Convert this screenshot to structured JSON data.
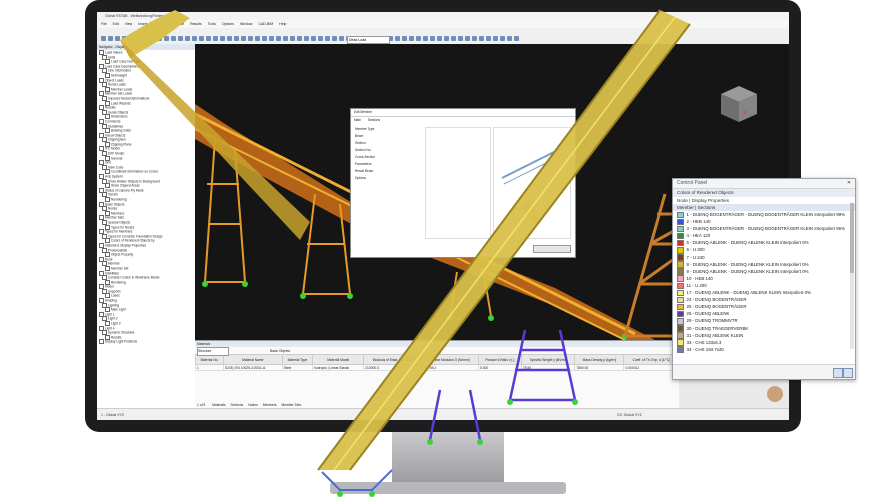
{
  "app": {
    "title": "Global RSTAB - Weitbandlung/Förderer_2_.rs9*",
    "menu": [
      "File",
      "Edit",
      "View",
      "Insert",
      "Assign",
      "Calculate",
      "Results",
      "Tools",
      "Options",
      "Window",
      "CAD-BIM",
      "Help"
    ],
    "load_case": "Dead Load"
  },
  "navigator": {
    "title": "Navigator - Display",
    "items": [
      "Load Values",
      "Units",
      "Load Case Numbers",
      "Load Case Descriptions",
      "Line Information",
      "Self-weight",
      "Object Loads",
      "Nodal Loads",
      "Member Loads",
      "Member Set Loads",
      "Imposed Nodal Deformations",
      "Load Wizards",
      "Results",
      "Guide Objects",
      "Dimensions",
      "Comments",
      "Guidelines",
      "Building Grids",
      "Visual Objects",
      "Clipping Box",
      "Clipping Plane",
      "IFC Model",
      "DXF Model",
      "General",
      "Grid",
      "View Cube",
      "Coordinate Information on Cursor",
      "Axis System",
      "Show Hidden Objects in Background",
      "Show Clipped Areas",
      "Status of Camera Fly Mode",
      "Terrain",
      "Numbering",
      "Basic Objects",
      "Nodes",
      "Members",
      "Member Sets",
      "Special Objects",
      "Types for Nodes",
      "Types for Members",
      "Types for Concrete Foundation Design",
      "Colors of Rendered Objects by",
      "Material & Display Properties",
      "Photorealistic",
      "Object Property",
      "Node",
      "Member",
      "Member Set",
      "Visibilities",
      "Consider Colors in Wireframe Model",
      "Rendering",
      "Model",
      "Supports",
      "Loads",
      "Shading",
      "Lighting",
      "Main Light",
      "Light 1",
      "Light 2",
      "Light 3",
      "Light 4",
      "Dynamic Shadows",
      "Results",
      "Display Light Positions"
    ]
  },
  "table": {
    "title": "Materials",
    "filter": "Structure",
    "buttons": [
      "Basic Objects"
    ],
    "headers": [
      "Material No.",
      "Material Name",
      "Material Type",
      "Material Model",
      "Modulus of Elast. E [N/mm²]",
      "Shear Modulus G [N/mm²]",
      "Poisson's Ratio v [-]",
      "Specific Weight γ [kN/m³]",
      "Mass Density ρ [kg/m³]",
      "Coeff. of Th. Exp. α [1/°C]"
    ],
    "rows": [
      [
        "1",
        "S235 | EN 10025-2:2004-11",
        "Steel",
        "Isotropic | Linear Elastic",
        "210000.0",
        "80769.2",
        "0.300",
        "78.50",
        "7850.00",
        "0.000012"
      ]
    ],
    "pagination": "1 of 5",
    "tabs": [
      "Materials",
      "Sections",
      "Nodes",
      "Members",
      "Member Sets"
    ]
  },
  "statusbar": {
    "left": "1 - Global XYZ",
    "right": "CS: Global XYZ"
  },
  "control_panel": {
    "title": "Control Panel",
    "subtitle": "Colors of Rendered Objects",
    "group": "Node | Display Properties",
    "section": "Member | Sections",
    "items": [
      {
        "label": "1 - DUENQ BOGENTRÄGER - DUENQ BOGENTRÄGER KLEIN Interpoliert 99%",
        "color": "#7fd0e8"
      },
      {
        "label": "2 - HEB 140",
        "color": "#2a55d8"
      },
      {
        "label": "3 - DUENQ BOGENTRÄGER - DUENQ BOGENTRÄGER KLEIN Interpoliert 95%",
        "color": "#7ed1c7"
      },
      {
        "label": "4 - HEA 120",
        "color": "#3b8a3b"
      },
      {
        "label": "5 - DUENQ ABLENK - DUENQ ABLENK KLEIN Interpoliert 0%",
        "color": "#e0282a"
      },
      {
        "label": "6 - U 300",
        "color": "#d9c500"
      },
      {
        "label": "7 - U 240",
        "color": "#7a3f1f"
      },
      {
        "label": "8 - DUENQ ABLENK - DUENQ ABLENK KLEIN Interpoliert 0%",
        "color": "#d6b43a"
      },
      {
        "label": "9 - DUENQ ABLENK - DUENQ ABLENK KLEIN Interpoliert 0%",
        "color": "#8c7c2e"
      },
      {
        "label": "10 - HEB 140",
        "color": "#f2a6b8"
      },
      {
        "label": "11 - U 200",
        "color": "#f06f6f"
      },
      {
        "label": "17 - DUENQ ABLENK - DUENQ ABLENK KLEIN Interpoliert 0%",
        "color": "#f5ef72"
      },
      {
        "label": "24 - DUENQ BOGENTRÄGER",
        "color": "#efd9a3"
      },
      {
        "label": "25 - DUENQ BOGENTRÄGER",
        "color": "#f0b441"
      },
      {
        "label": "26 - DUENQ ABLENK",
        "color": "#5b3f93"
      },
      {
        "label": "29 - DUENQ TROMMVTR",
        "color": "#c9c4dd"
      },
      {
        "label": "30 - DUENQ TRAEGERVERBK",
        "color": "#6b5b32"
      },
      {
        "label": "31 - DUENQ ABLENK KLEIN",
        "color": "#b8ab79"
      },
      {
        "label": "33 - CHS 133x6.3",
        "color": "#f5e76e"
      },
      {
        "label": "34 - CHS 193.7x20",
        "color": "#6f7a9e"
      }
    ]
  },
  "dialog": {
    "title": "Edit Member",
    "tabs": [
      "Main",
      "Sections"
    ],
    "labels": [
      "Member Type",
      "Beam",
      "Section",
      "Section No.",
      "Cross-Section",
      "Parameters",
      "Result Beam",
      "Options"
    ]
  },
  "colors": {
    "viewport_bg": "#151515",
    "truss_yellow": "#e8c820",
    "truss_orange": "#e47a1c",
    "support_green": "#3bd13b",
    "tower_purple": "#5a3ad0"
  }
}
